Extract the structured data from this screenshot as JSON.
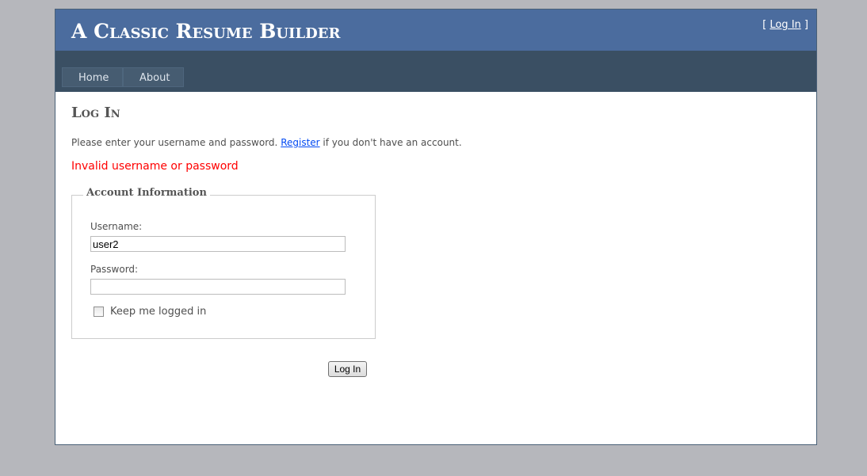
{
  "header": {
    "title": "A Classic Resume Builder",
    "login_bracket_open": "[ ",
    "login_link": "Log In",
    "login_bracket_close": " ]"
  },
  "menu": {
    "items": [
      {
        "label": "Home"
      },
      {
        "label": "About"
      }
    ]
  },
  "main": {
    "heading": "Log In",
    "intro_before": "Please enter your username and password. ",
    "register_link": "Register",
    "intro_after": " if you don't have an account.",
    "error": "Invalid username or password"
  },
  "form": {
    "legend": "Account Information",
    "username_label": "Username:",
    "username_value": "user2",
    "password_label": "Password:",
    "password_value": "",
    "remember_label": "Keep me logged in",
    "remember_checked": false,
    "submit_label": "Log In"
  },
  "colors": {
    "background": "#b6b7bc",
    "header": "#4b6c9e",
    "menu_bar": "#3a4f63",
    "menu_item": "#465c71",
    "error": "#ff0000",
    "link": "#034af3"
  }
}
